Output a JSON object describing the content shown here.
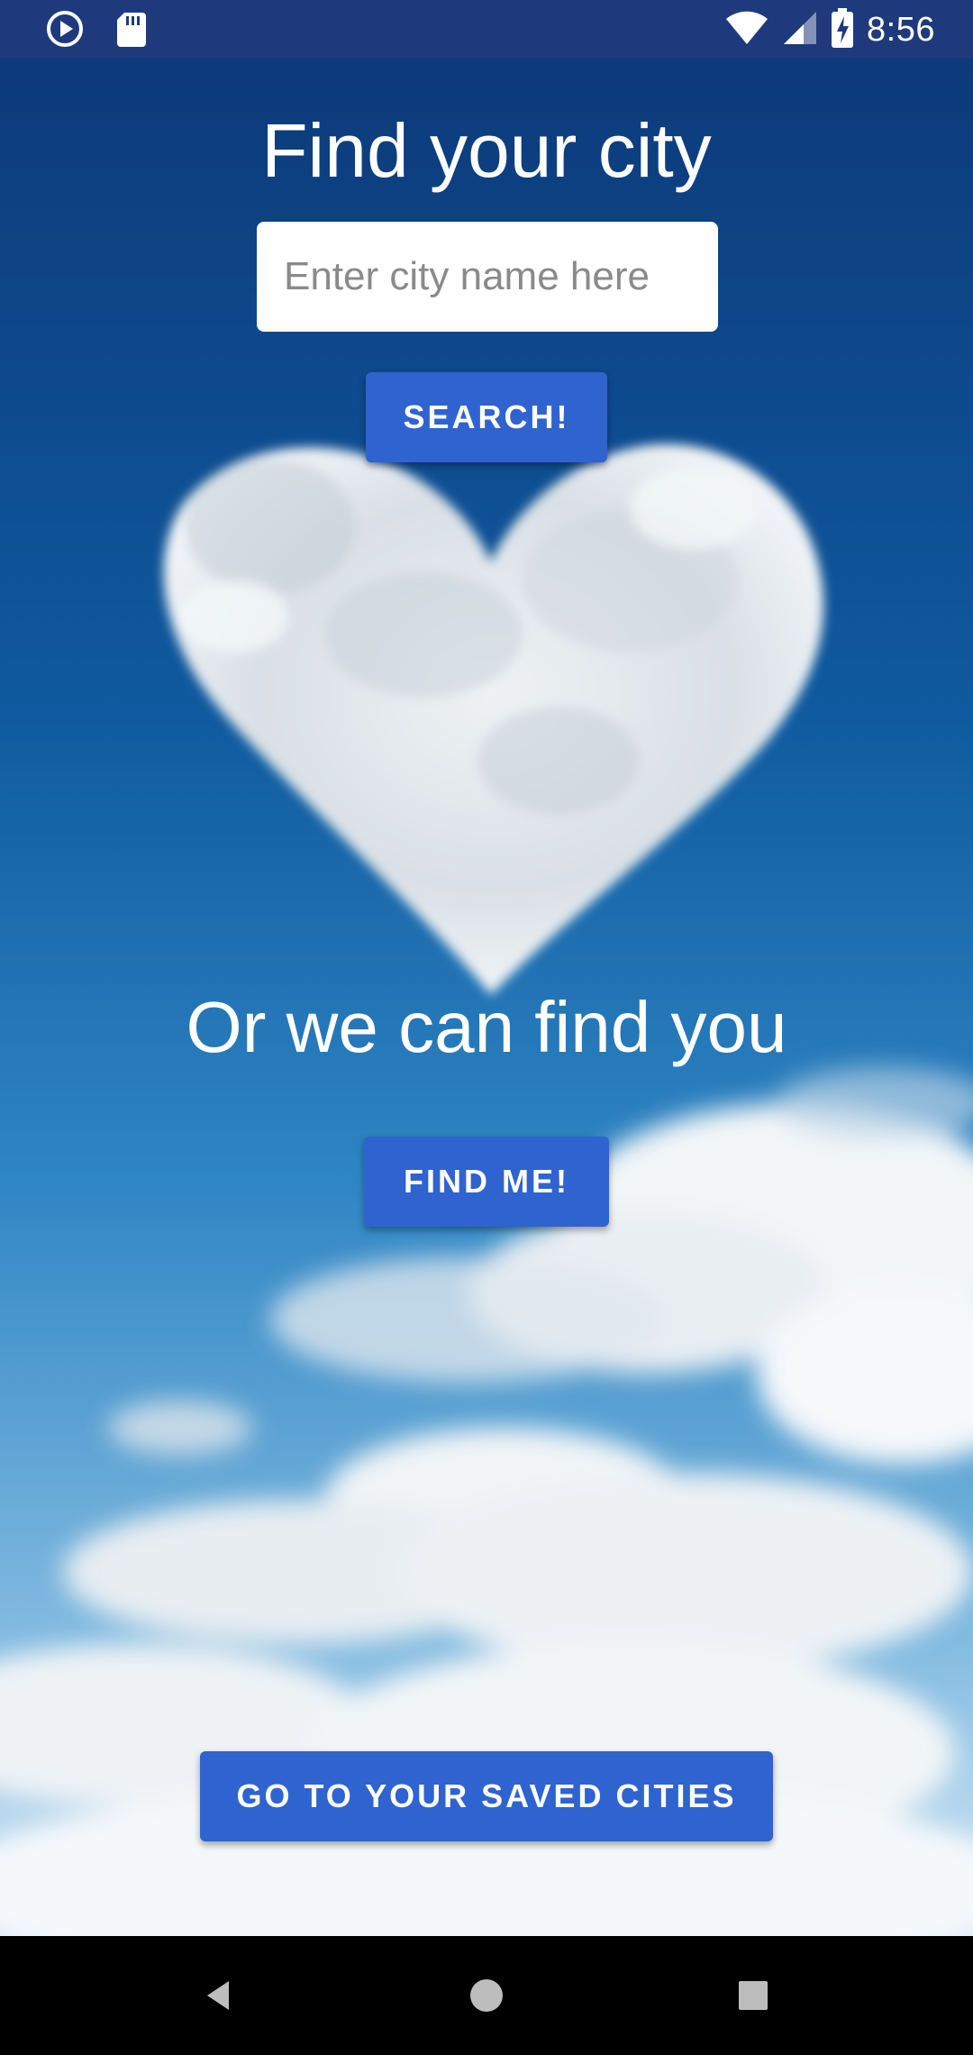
{
  "status_bar": {
    "time": "8:56",
    "icons": [
      "play-icon",
      "sd-card-icon",
      "wifi-icon",
      "signal-icon",
      "battery-charging-icon"
    ]
  },
  "main": {
    "title": "Find your city",
    "search_placeholder": "Enter city name here",
    "search_button_label": "SEARCH!",
    "subtitle": "Or we can find you",
    "find_me_button_label": "FIND ME!",
    "saved_cities_button_label": "GO TO YOUR SAVED CITIES"
  },
  "navigation_bar": {
    "icons": [
      "back-icon",
      "home-icon",
      "recents-icon"
    ]
  },
  "colors": {
    "status_bar": "#1f3a7c",
    "button": "#2f63cf",
    "sky_top": "#0c3f7f",
    "sky_bottom": "#b7d8ee"
  }
}
